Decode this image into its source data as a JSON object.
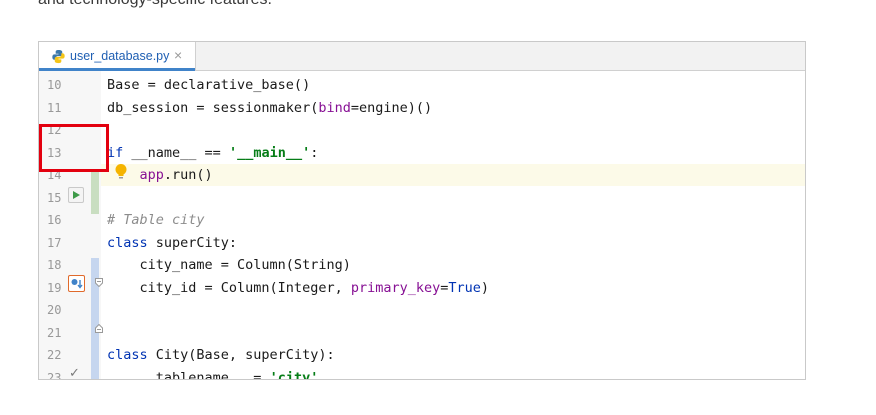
{
  "intro_text": "and technology-specific features.",
  "editor": {
    "tab": {
      "filename": "user_database.py",
      "close_glyph": "×"
    },
    "lines": [
      {
        "num": "10",
        "segments": [
          {
            "t": "Base = declarative_base()",
            "c": ""
          }
        ]
      },
      {
        "num": "11",
        "segments": [
          {
            "t": "db_session = sessionmaker(",
            "c": ""
          },
          {
            "t": "bind",
            "c": "param"
          },
          {
            "t": "=engine)()",
            "c": ""
          }
        ]
      },
      {
        "num": "12",
        "segments": []
      },
      {
        "num": "13",
        "segments": [
          {
            "t": "if",
            "c": "kw"
          },
          {
            "t": " __name__ == ",
            "c": ""
          },
          {
            "t": "'__main__'",
            "c": "str"
          },
          {
            "t": ":",
            "c": ""
          }
        ]
      },
      {
        "num": "14",
        "segments": [
          {
            "t": "    app",
            "c": "param"
          },
          {
            "t": ".run()",
            "c": ""
          }
        ]
      },
      {
        "num": "15",
        "segments": []
      },
      {
        "num": "16",
        "segments": [
          {
            "t": "# Table city",
            "c": "comment"
          }
        ]
      },
      {
        "num": "17",
        "segments": [
          {
            "t": "class",
            "c": "kw"
          },
          {
            "t": " superCity:",
            "c": ""
          }
        ]
      },
      {
        "num": "18",
        "segments": [
          {
            "t": "    city_name = Column(String)",
            "c": ""
          }
        ]
      },
      {
        "num": "19",
        "segments": [
          {
            "t": "    city_id = Column(Integer, ",
            "c": ""
          },
          {
            "t": "primary_key",
            "c": "param"
          },
          {
            "t": "=",
            "c": ""
          },
          {
            "t": "True",
            "c": "const"
          },
          {
            "t": ")",
            "c": ""
          }
        ]
      },
      {
        "num": "20",
        "segments": []
      },
      {
        "num": "21",
        "segments": []
      },
      {
        "num": "22",
        "segments": [
          {
            "t": "class",
            "c": "kw"
          },
          {
            "t": " City(Base, superCity):",
            "c": ""
          }
        ]
      },
      {
        "num": "23",
        "segments": [
          {
            "t": "    __tablename__ = ",
            "c": ""
          },
          {
            "t": "'city'",
            "c": "str"
          }
        ]
      }
    ],
    "check_glyph": "✓",
    "colors": {
      "run_green": "#3d9a48",
      "highlight_red": "#e3000f",
      "override_orange": "#e06a2b",
      "tab_accent": "#4083c9"
    }
  }
}
